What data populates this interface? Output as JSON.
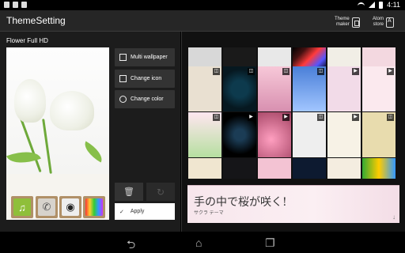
{
  "status_bar": {
    "time": "4:11"
  },
  "action_bar": {
    "title": "ThemeSetting",
    "theme_maker": "Theme\nmaker",
    "atom_store": "Atom\nstore"
  },
  "theme": {
    "name": "Flower Full HD"
  },
  "buttons": {
    "multi_wallpaper": "Multi wallpaper",
    "change_icon": "Change icon",
    "change_color": "Change color",
    "apply": "Apply"
  },
  "banner": {
    "text": "手の中で桜が咲く!",
    "sub": "サクラ テーマ"
  },
  "colors": {
    "action_bar": "#262626",
    "panel": "#1c1c1c",
    "button": "#333333",
    "banner_bg": "#f7e6ec",
    "accent_pink": "#e6407a"
  },
  "icons": [
    "music-note-icon",
    "phone-icon",
    "camera-icon",
    "tv-icon",
    "gallery-icon",
    "trash-icon",
    "refresh-icon",
    "checkmark-icon",
    "back-icon",
    "home-icon",
    "recents-icon"
  ]
}
